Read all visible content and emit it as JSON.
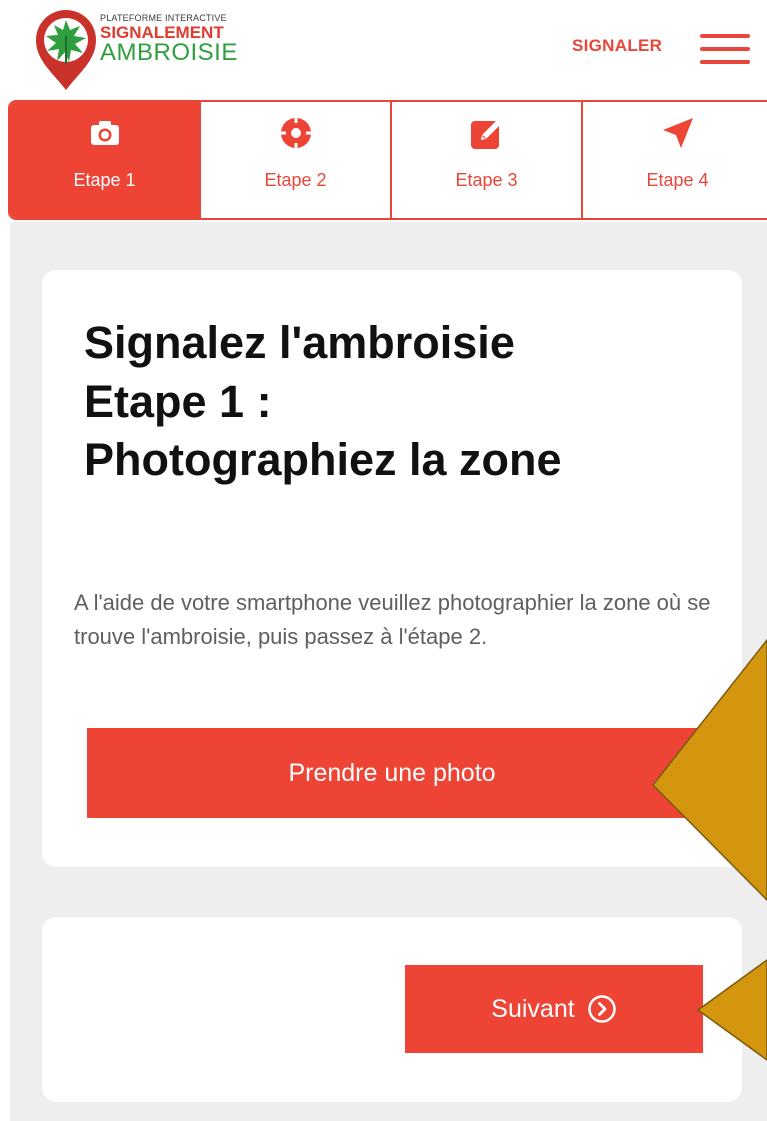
{
  "header": {
    "logo_line1": "PLATEFORME INTERACTIVE",
    "logo_line2": "SIGNALEMENT",
    "logo_line3": "AMBROISIE",
    "signaler_label": "SIGNALER",
    "menu_icon": "hamburger-menu-icon"
  },
  "steps": [
    {
      "label": "Etape 1",
      "icon": "camera-icon",
      "active": true
    },
    {
      "label": "Etape 2",
      "icon": "location-target-icon",
      "active": false
    },
    {
      "label": "Etape 3",
      "icon": "edit-pencil-icon",
      "active": false
    },
    {
      "label": "Etape 4",
      "icon": "send-arrow-icon",
      "active": false
    }
  ],
  "card": {
    "title_line1": "Signalez l'ambroisie",
    "title_line2": "Etape 1 :",
    "title_line3": "Photographiez la zone",
    "description": "A l'aide de votre smartphone veuillez photographier la zone où se trouve l'ambroisie, puis passez à l'étape 2.",
    "photo_button": "Prendre une photo"
  },
  "navigation": {
    "next_button": "Suivant",
    "next_icon": "chevron-right-circle-icon"
  },
  "colors": {
    "accent": "#ee4436",
    "logo_green": "#2f9e3f",
    "background": "#eeeeee",
    "annotation": "#d4960e"
  }
}
